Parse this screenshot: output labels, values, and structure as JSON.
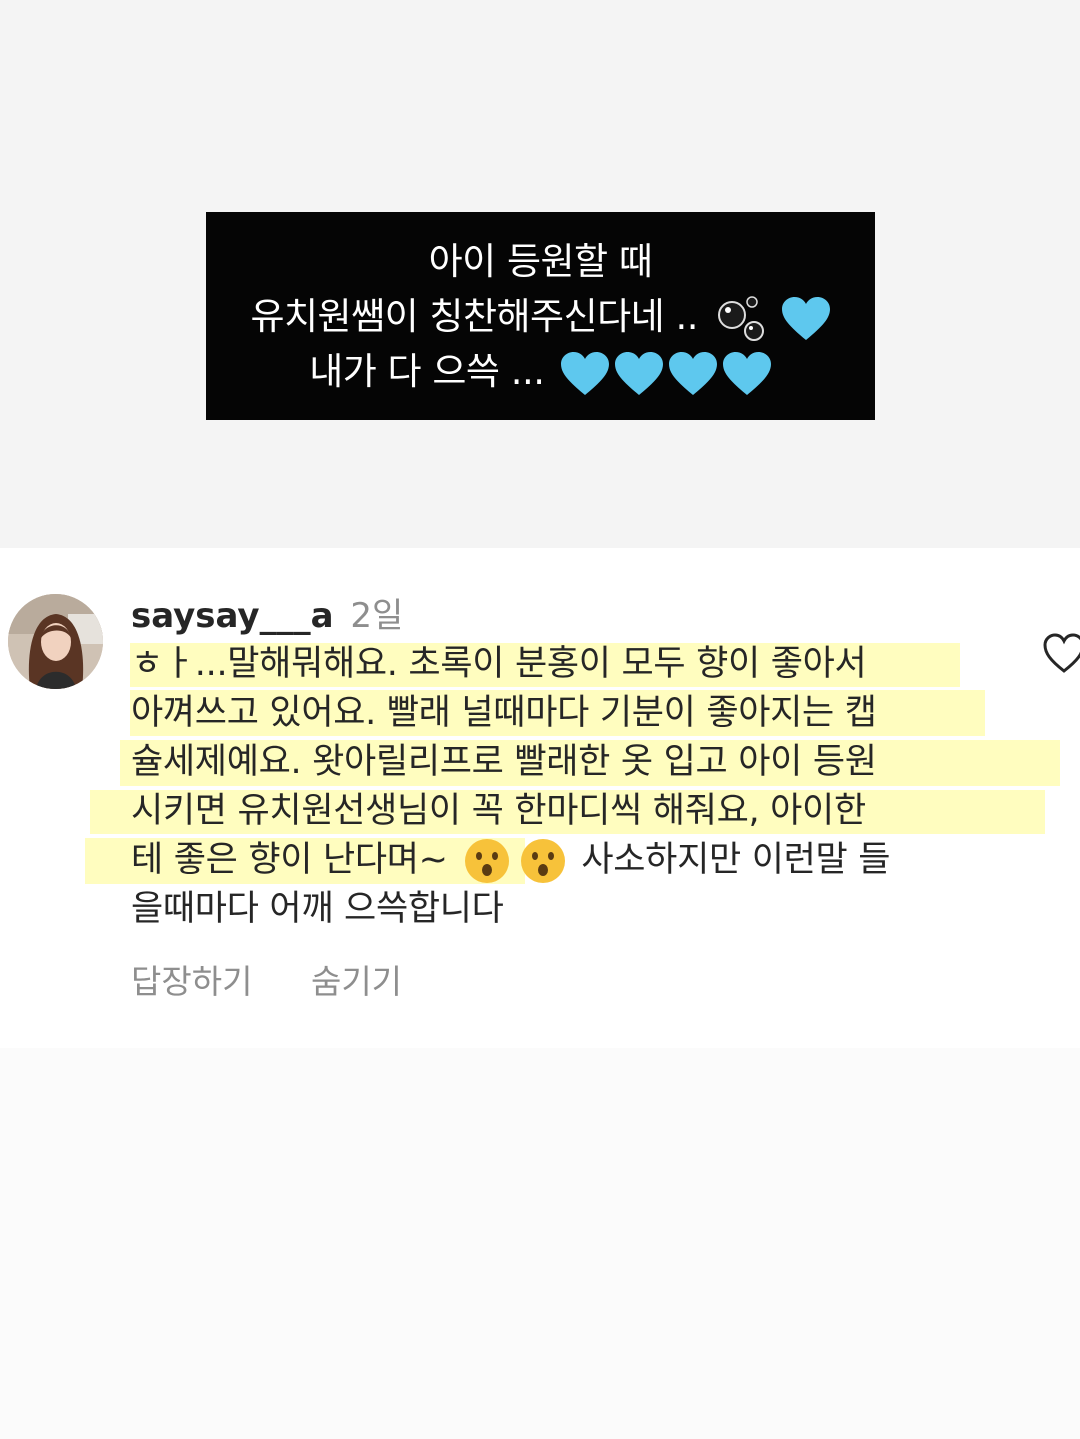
{
  "story": {
    "line1": "아이 등원할 때",
    "line2": "유치원쌤이 칭찬해주신다네 ..",
    "line3": "내가 다 으쓱 ...",
    "heart_color": "#5ec8ee"
  },
  "comment": {
    "username": "saysay___a",
    "timestamp": "2일",
    "lines": [
      "ㅎㅏ...말해뭐해요. 초록이 분홍이 모두 향이 좋아서",
      "아껴쓰고 있어요. 빨래 널때마다 기분이 좋아지는 캡",
      "슐세제예요. 왓아릴리프로 빨래한 옷 입고 아이 등원",
      "시키면 유치원선생님이 꼭 한마디씩 해줘요, 아이한",
      "테 좋은 향이 난다며~",
      "사소하지만 이런말 들",
      "을때마다 어깨 으쓱합니다"
    ],
    "highlight_color": "#fffcaa"
  },
  "actions": {
    "reply_label": "답장하기",
    "hide_label": "숨기기"
  }
}
